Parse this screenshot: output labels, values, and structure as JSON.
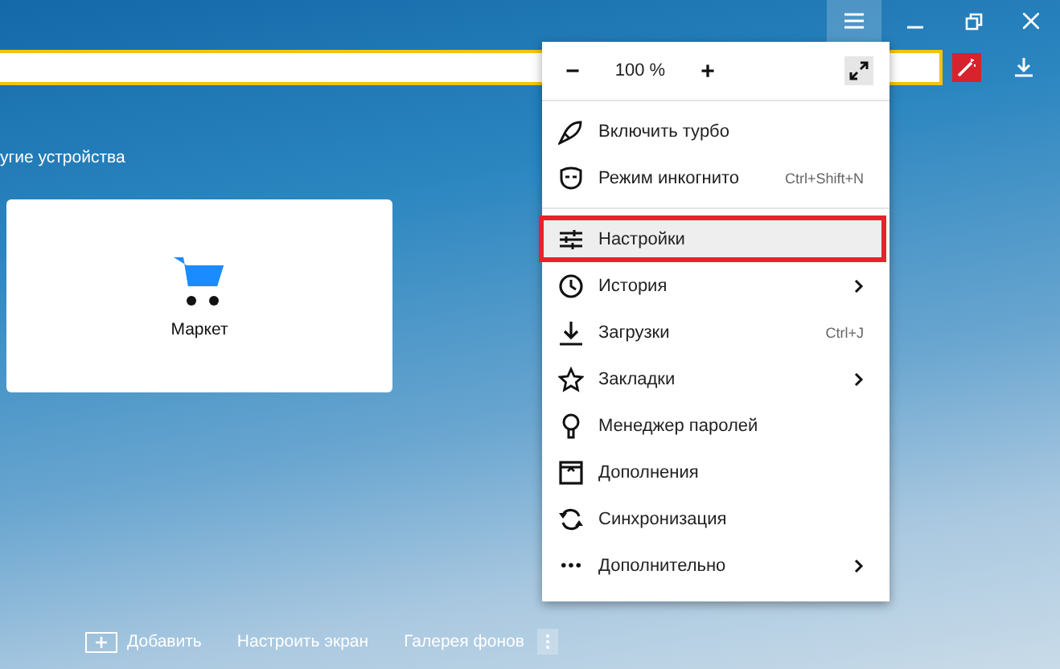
{
  "heading": "угие устройства",
  "tiles": [
    {
      "label": "Маркет"
    }
  ],
  "bottom_bar": {
    "add": "Добавить",
    "customize": "Настроить экран",
    "gallery": "Галерея фонов"
  },
  "menu": {
    "zoom": {
      "minus": "−",
      "value": "100 %",
      "plus": "+"
    },
    "sections": [
      [
        {
          "label": "Включить турбо",
          "submenu": false,
          "selected": false
        },
        {
          "label": "Режим инкогнито",
          "shortcut": "Ctrl+Shift+N",
          "submenu": false,
          "selected": false
        }
      ],
      [
        {
          "label": "Настройки",
          "submenu": false,
          "selected": true
        },
        {
          "label": "История",
          "submenu": true,
          "selected": false
        },
        {
          "label": "Загрузки",
          "shortcut": "Ctrl+J",
          "submenu": false,
          "selected": false
        },
        {
          "label": "Закладки",
          "submenu": true,
          "selected": false
        },
        {
          "label": "Менеджер паролей",
          "submenu": false,
          "selected": false
        },
        {
          "label": "Дополнения",
          "submenu": false,
          "selected": false
        },
        {
          "label": "Синхронизация",
          "submenu": false,
          "selected": false
        },
        {
          "label": "Дополнительно",
          "submenu": true,
          "selected": false
        }
      ]
    ]
  }
}
